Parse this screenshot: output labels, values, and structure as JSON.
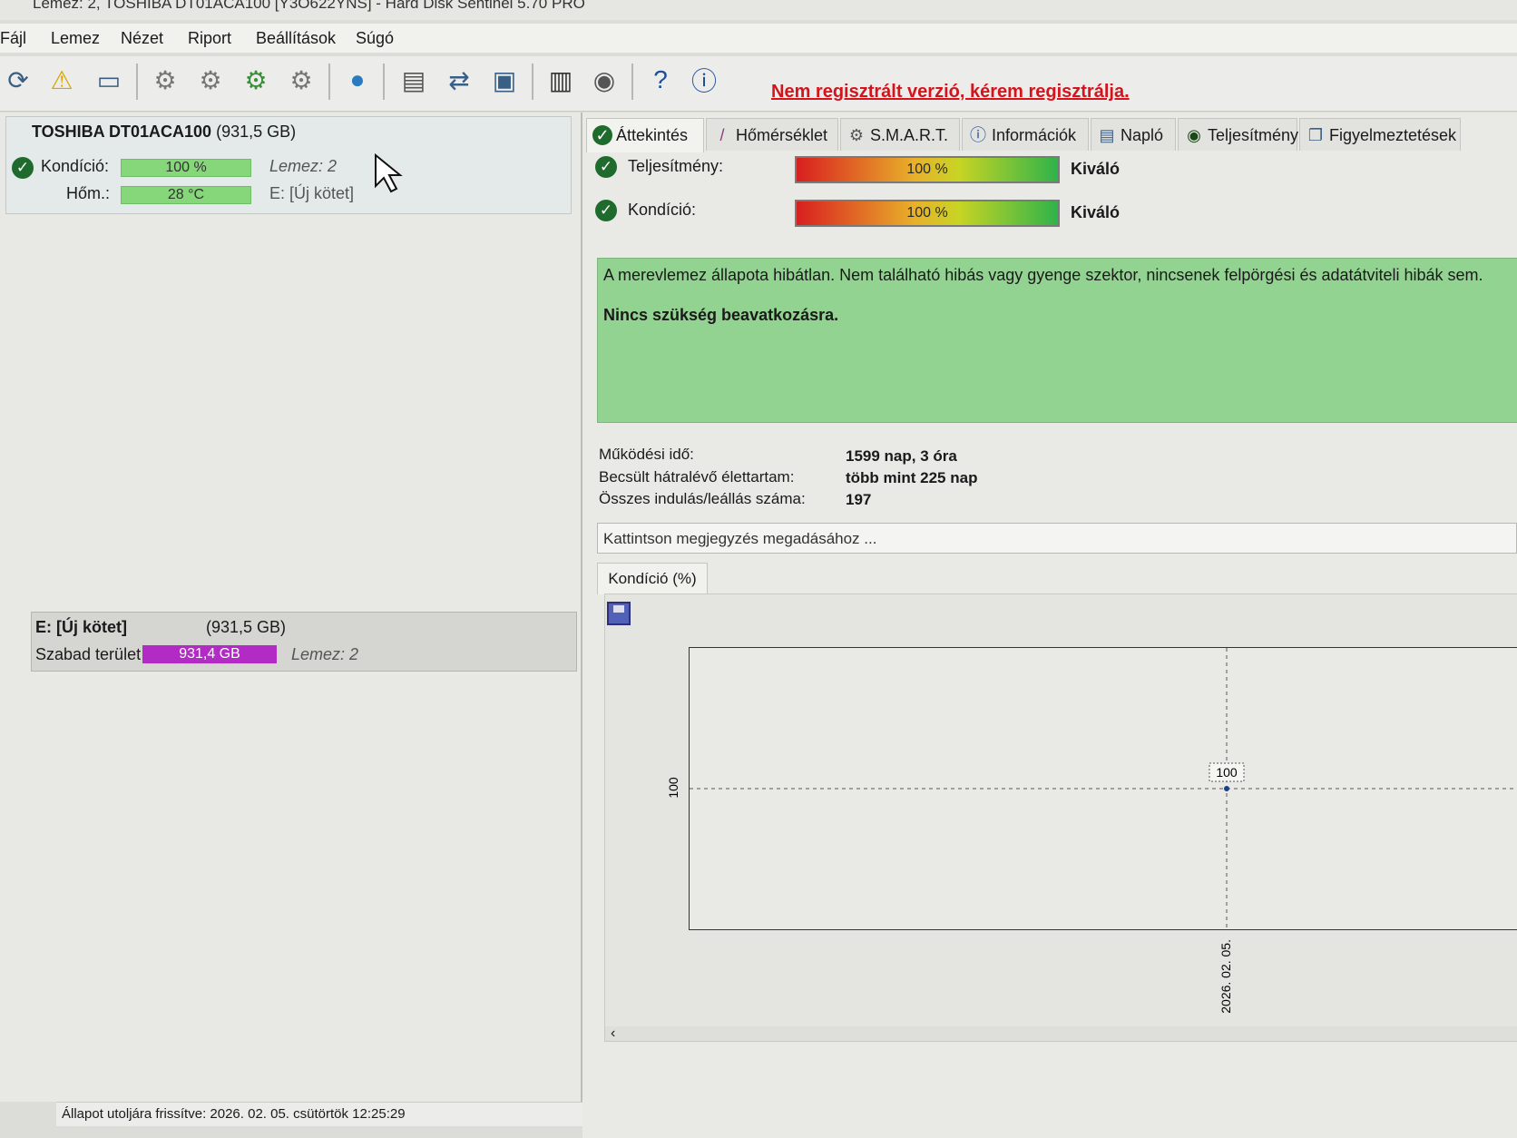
{
  "window": {
    "title": "Lemez: 2, TOSHIBA DT01ACA100 [Y3O622YNS]  -  Hard Disk Sentinel 5.70 PRO"
  },
  "menu": [
    "Fájl",
    "Lemez",
    "Nézet",
    "Riport",
    "Beállítások",
    "Súgó"
  ],
  "toolbar": {
    "icons": [
      "refresh-icon",
      "warning-disk-icon",
      "disk-info-icon",
      "test-icon-1",
      "test-icon-2",
      "test-icon-3",
      "test-icon-4",
      "web-icon",
      "report-icon",
      "sync-icon",
      "network-icon",
      "monitor-icon",
      "speaker-icon",
      "help-icon",
      "info-icon"
    ],
    "register_link": "Nem regisztrált verzió, kérem regisztrálja."
  },
  "disk": {
    "model": "TOSHIBA DT01ACA100",
    "size": "(931,5 GB)",
    "condition_label": "Kondíció:",
    "condition_value": "100 %",
    "condition_pct": 100,
    "disk_label": "Lemez: 2",
    "temp_label": "Hőm.:",
    "temp_value": "28 °C",
    "volume_label": "E: [Új kötet]"
  },
  "volume": {
    "name": "E: [Új kötet]",
    "size": "(931,5 GB)",
    "free_label": "Szabad terület",
    "free_value": "931,4 GB",
    "disk_label": "Lemez: 2"
  },
  "statusbar": {
    "text": "Állapot utoljára frissítve: 2026. 02. 05. csütörtök 12:25:29"
  },
  "tabs": [
    {
      "label": "Áttekintés",
      "icon": "check-icon"
    },
    {
      "label": "Hőmérséklet",
      "icon": "thermometer-icon"
    },
    {
      "label": "S.M.A.R.T.",
      "icon": "smart-icon"
    },
    {
      "label": "Információk",
      "icon": "info-icon"
    },
    {
      "label": "Napló",
      "icon": "log-icon"
    },
    {
      "label": "Teljesítmény",
      "icon": "performance-icon"
    },
    {
      "label": "Figyelmeztetések",
      "icon": "alerts-icon"
    }
  ],
  "overview": {
    "performance_label": "Teljesítmény:",
    "performance_value": "100 %",
    "performance_rating": "Kiváló",
    "condition_label": "Kondíció:",
    "condition_value": "100 %",
    "condition_rating": "Kiváló",
    "message": "A merevlemez állapota hibátlan. Nem található hibás vagy gyenge szektor, nincsenek felpörgési és adatátviteli hibák sem.",
    "action": "Nincs szükség beavatkozásra.",
    "uptime_label": "Működési idő:",
    "uptime_value": "1599 nap, 3 óra",
    "lifetime_label": "Becsült hátralévő élettartam:",
    "lifetime_value": "több mint 225 nap",
    "startstop_label": "Összes indulás/leállás száma:",
    "startstop_value": "197",
    "note_placeholder": "Kattintson megjegyzés megadásához ...",
    "chart_tab": "Kondíció  (%)"
  },
  "colors": {
    "accent_red": "#d4141c",
    "health_green": "#93d391",
    "bar_green": "#86d67a",
    "free_purple": "#b12bc4"
  },
  "chart_data": {
    "type": "line",
    "x": [
      "2026. 02. 05."
    ],
    "series": [
      {
        "values": [
          100
        ]
      }
    ],
    "ytick": "100",
    "point_label": "100",
    "xtick": "2026. 02. 05."
  }
}
